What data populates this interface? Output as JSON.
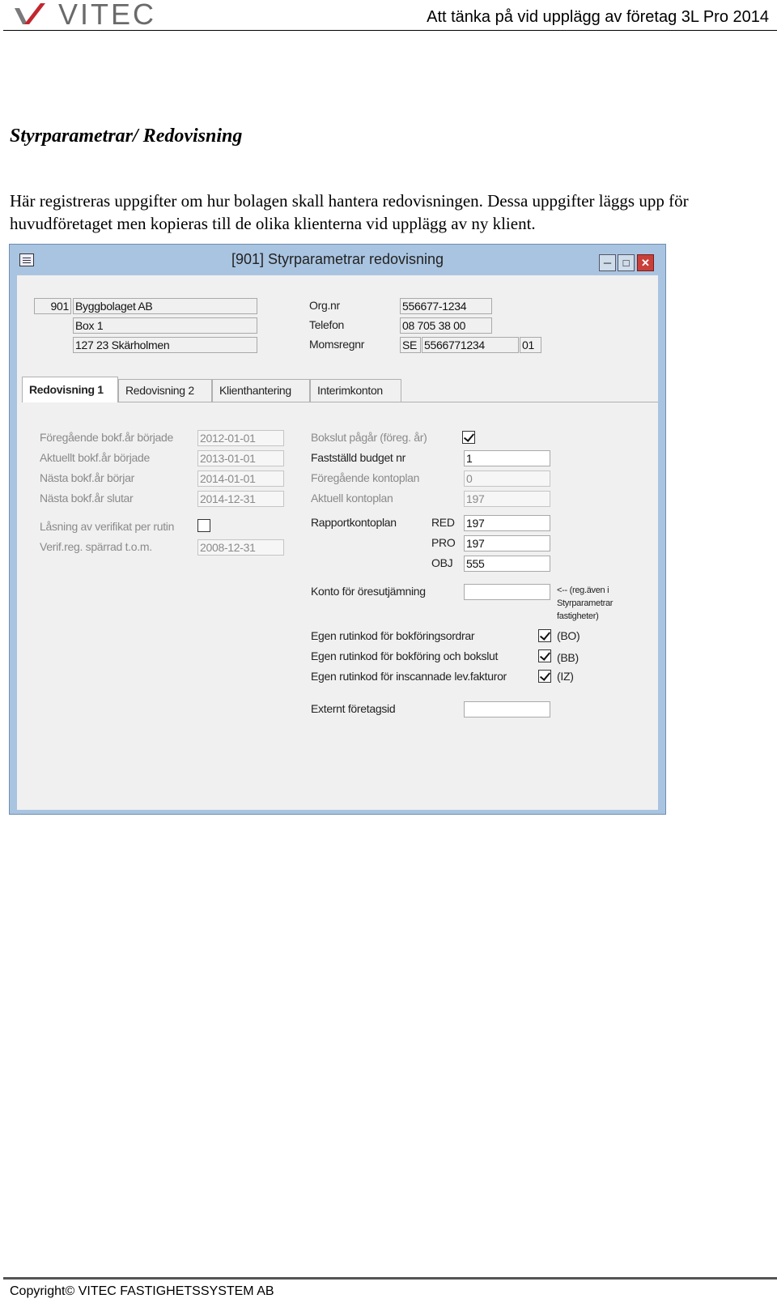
{
  "header": {
    "brand": "VITEC",
    "title": "Att tänka på vid upplägg av företag 3L Pro 2014"
  },
  "doc": {
    "heading": "Styrparametrar/  Redovisning",
    "paragraph": "Här registreras uppgifter om hur bolagen skall hantera redovisningen. Dessa uppgifter läggs upp för huvudföretaget men kopieras till de olika klienterna vid upplägg av ny klient."
  },
  "window": {
    "title": "[901]  Styrparametrar redovisning",
    "company": {
      "number": "901",
      "name": "Byggbolaget AB",
      "address1": "Box 1",
      "address2": "127 23  Skärholmen",
      "orgnr_label": "Org.nr",
      "orgnr": "556677-1234",
      "telefon_label": "Telefon",
      "telefon": "08 705 38 00",
      "moms_label": "Momsregnr",
      "moms_prefix": "SE",
      "moms_number": "5566771234",
      "moms_suffix": "01"
    },
    "tabs": [
      {
        "label": "Redovisning 1",
        "active": true
      },
      {
        "label": "Redovisning 2",
        "active": false
      },
      {
        "label": "Klienthantering",
        "active": false
      },
      {
        "label": "Interimkonton",
        "active": false
      }
    ],
    "left": {
      "foreg_label": "Föregående bokf.år började",
      "foreg_value": "2012-01-01",
      "aktuellt_label": "Aktuellt bokf.år började",
      "aktuellt_value": "2013-01-01",
      "nasta_borjar_label": "Nästa bokf.år börjar",
      "nasta_borjar_value": "2014-01-01",
      "nasta_slutar_label": "Nästa bokf.år slutar",
      "nasta_slutar_value": "2014-12-31",
      "lasning_label": "Låsning av verifikat per rutin",
      "lasning_checked": false,
      "verif_label": "Verif.reg. spärrad t.o.m.",
      "verif_value": "2008-12-31"
    },
    "right": {
      "bokslut_label": "Bokslut pågår (föreg. år)",
      "bokslut_checked": true,
      "budget_label": "Fastställd budget nr",
      "budget_value": "1",
      "foreg_kontoplan_label": "Föregående kontoplan",
      "foreg_kontoplan_value": "0",
      "aktuell_kontoplan_label": "Aktuell kontoplan",
      "aktuell_kontoplan_value": "197",
      "rapport_label": "Rapportkontoplan",
      "red_label": "RED",
      "red_value": "197",
      "pro_label": "PRO",
      "pro_value": "197",
      "obj_label": "OBJ",
      "obj_value": "555",
      "konto_ore_label": "Konto för öresutjämning",
      "konto_ore_value": "",
      "konto_ore_note_1": "<-- (reg.även i",
      "konto_ore_note_2": "Styrparametrar",
      "konto_ore_note_3": "fastigheter)",
      "egen_bo_label": "Egen rutinkod för bokföringsordrar",
      "egen_bo_code": "(BO)",
      "egen_bo_checked": true,
      "egen_bb_label": "Egen rutinkod för bokföring och bokslut",
      "egen_bb_code": "(BB)",
      "egen_bb_checked": true,
      "egen_iz_label": "Egen rutinkod för inscannade lev.fakturor",
      "egen_iz_code": "(IZ)",
      "egen_iz_checked": true,
      "externt_label": "Externt företagsid",
      "externt_value": ""
    }
  },
  "footer": {
    "copyright": "Copyright© VITEC FASTIGHETSSYSTEM AB"
  }
}
